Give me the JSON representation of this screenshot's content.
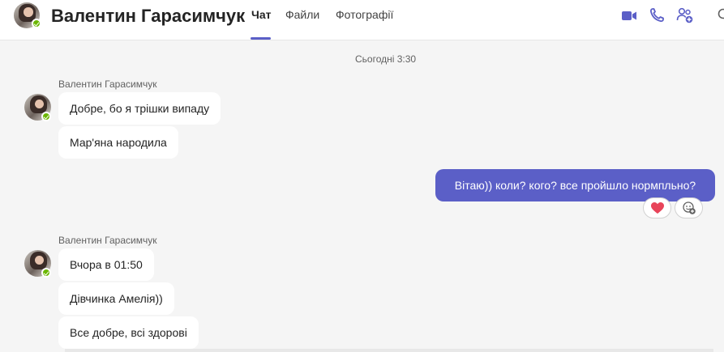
{
  "header": {
    "title": "Валентин Гарасимчук",
    "tabs": [
      {
        "label": "Чат",
        "active": true
      },
      {
        "label": "Файли",
        "active": false
      },
      {
        "label": "Фотографії",
        "active": false
      }
    ],
    "actions": [
      "video-call-icon",
      "audio-call-icon",
      "add-people-icon",
      "search-icon"
    ]
  },
  "chat": {
    "timestamp": "Сьогодні 3:30",
    "groups": [
      {
        "sender": "Валентин Гарасимчук",
        "messages": [
          "Добре, бо я трішки випаду",
          "Мар'яна народила"
        ]
      },
      {
        "sender": "Валентин Гарасимчук",
        "messages": [
          "Вчора в 01:50",
          "Дівчинка Амелія))",
          "Все добре, всі здорові"
        ]
      }
    ],
    "outgoing": {
      "text": "Вітаю)) коли? кого? все пройшло нормпльно?",
      "reactions": [
        "heart-icon",
        "add-reaction-icon"
      ]
    }
  },
  "colors": {
    "accent": "#5b5fc7",
    "presence": "#6bb700",
    "background": "#f5f5f5"
  }
}
